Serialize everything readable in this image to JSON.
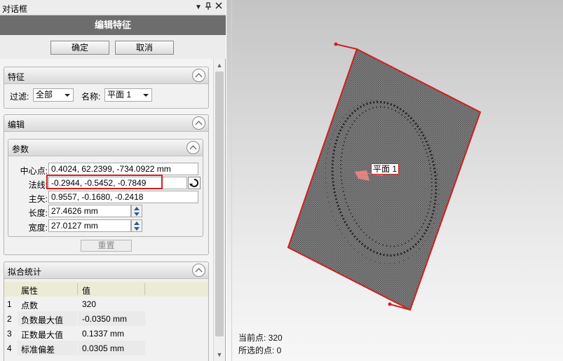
{
  "panel": {
    "title": "对话框",
    "titlebar_buttons": [
      "▾",
      "ꟷ",
      "✕"
    ],
    "header": "编辑特征",
    "ok_label": "确定",
    "cancel_label": "取消"
  },
  "feature_group": {
    "title": "特征",
    "filter_label": "过滤:",
    "filter_value": "全部",
    "name_label": "名称:",
    "name_value": "平面 1"
  },
  "edit_group": {
    "title": "编辑",
    "params": {
      "title": "参数",
      "center_label": "中心点:",
      "center_value": "0.4024, 62.2399, -734.0922 mm",
      "normal_label": "法线:",
      "normal_value": "-0.2944, -0.5452, -0.7849",
      "major_label": "主矢:",
      "major_value": "0.9557, -0.1680, -0.2418",
      "length_label": "长度:",
      "length_value": "27.4626 mm",
      "width_label": "宽度:",
      "width_value": "27.0127 mm"
    },
    "reset_label": "重置"
  },
  "fit_stats": {
    "title": "拟合统计",
    "headers": [
      "属性",
      "值"
    ],
    "rows": [
      {
        "index": "1",
        "property": "点数",
        "value": "320"
      },
      {
        "index": "2",
        "property": "负数最大值",
        "value": "-0.0350 mm"
      },
      {
        "index": "3",
        "property": "正数最大值",
        "value": "0.1337 mm"
      },
      {
        "index": "4",
        "property": "标准偏差",
        "value": "0.0305 mm"
      }
    ]
  },
  "viewport": {
    "plane_label": "平面 1",
    "current_point_label": "当前点: 320",
    "selected_points_label": "所选的点: 0"
  },
  "colors": {
    "accent_red": "#d02020",
    "header_band": "#6d6d6d",
    "table_header": "#ececd6",
    "table_cell": "#eaeaea"
  }
}
